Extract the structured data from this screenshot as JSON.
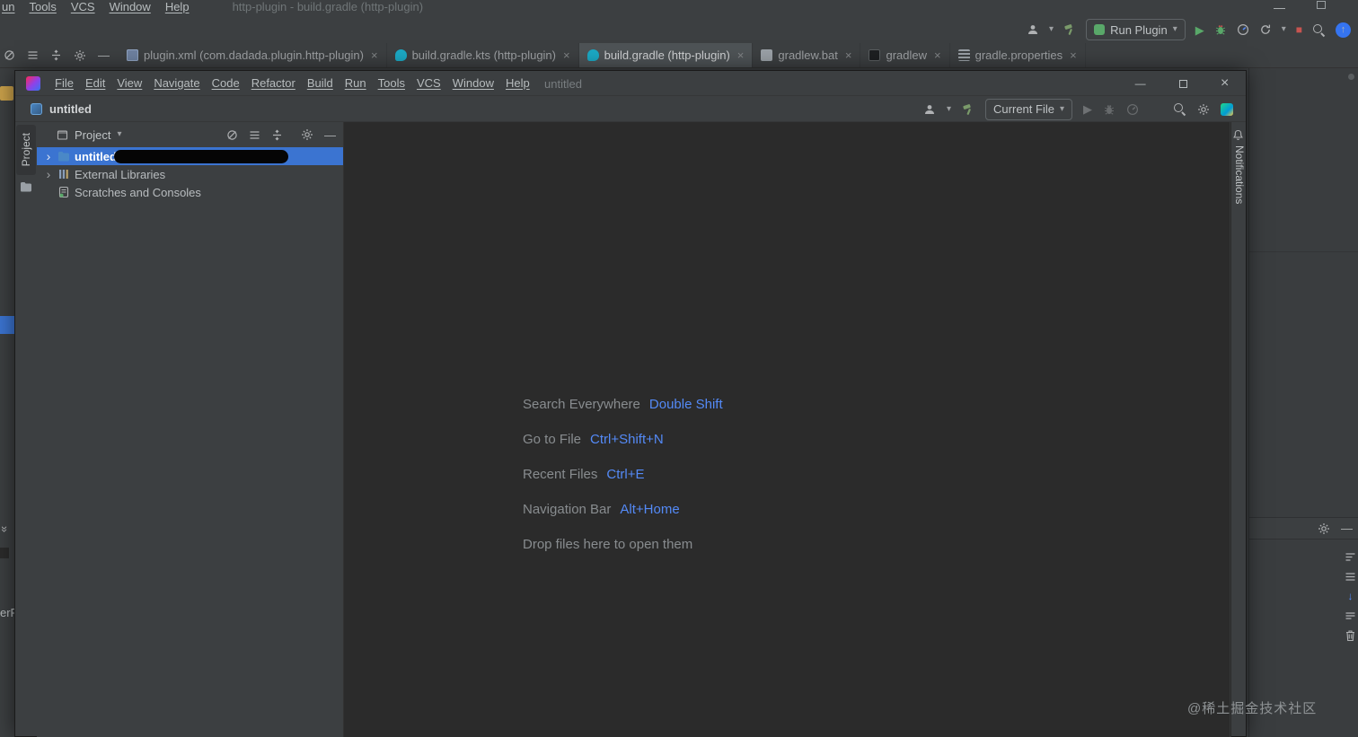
{
  "glyphs": {
    "caret_down": "▾",
    "chevron_right": "›",
    "close": "×",
    "play": "▶",
    "stop": "■",
    "minus": "—",
    "arrow_up": "↑",
    "arrow_down": "↓",
    "double_chevron": "»"
  },
  "outer": {
    "menubar": {
      "items": [
        "un",
        "Tools",
        "VCS",
        "Window",
        "Help"
      ],
      "title": "http-plugin - build.gradle (http-plugin)"
    },
    "toolbar": {
      "run_config": "Run Plugin"
    },
    "tabs": [
      {
        "label": "plugin.xml (com.dadada.plugin.http-plugin)",
        "icon": "xml-file-icon"
      },
      {
        "label": "build.gradle.kts (http-plugin)",
        "icon": "gradle-file-icon"
      },
      {
        "label": "build.gradle (http-plugin)",
        "icon": "gradle-file-icon"
      },
      {
        "label": "gradlew.bat",
        "icon": "bat-file-icon"
      },
      {
        "label": "gradlew",
        "icon": "shell-file-icon"
      },
      {
        "label": "gradle.properties",
        "icon": "properties-file-icon"
      }
    ],
    "left_edge_text": "erFi",
    "watermark": "@稀土掘金技术社区"
  },
  "inner": {
    "titlebar": {
      "menu": [
        "File",
        "Edit",
        "View",
        "Navigate",
        "Code",
        "Refactor",
        "Build",
        "Run",
        "Tools",
        "VCS",
        "Window",
        "Help"
      ],
      "title": "untitled"
    },
    "toolbar": {
      "project": "untitled",
      "run_config": "Current File"
    },
    "project_panel": {
      "header": "Project",
      "tree": [
        {
          "label": "untitled"
        },
        {
          "label": "External Libraries"
        },
        {
          "label": "Scratches and Consoles"
        }
      ]
    },
    "stripes": {
      "left": "Project",
      "right": "Notifications"
    },
    "editor": {
      "hints": [
        {
          "label": "Search Everywhere",
          "key": "Double Shift"
        },
        {
          "label": "Go to File",
          "key": "Ctrl+Shift+N"
        },
        {
          "label": "Recent Files",
          "key": "Ctrl+E"
        },
        {
          "label": "Navigation Bar",
          "key": "Alt+Home"
        },
        {
          "label": "Drop files here to open them",
          "key": ""
        }
      ]
    }
  },
  "colors": {
    "selection_blue": "#3b74d1",
    "shortcut_blue": "#548af7",
    "run_green": "#59a869",
    "stop_red": "#c75450",
    "editor_bg": "#2b2b2b",
    "panel_bg": "#3c3f41"
  }
}
